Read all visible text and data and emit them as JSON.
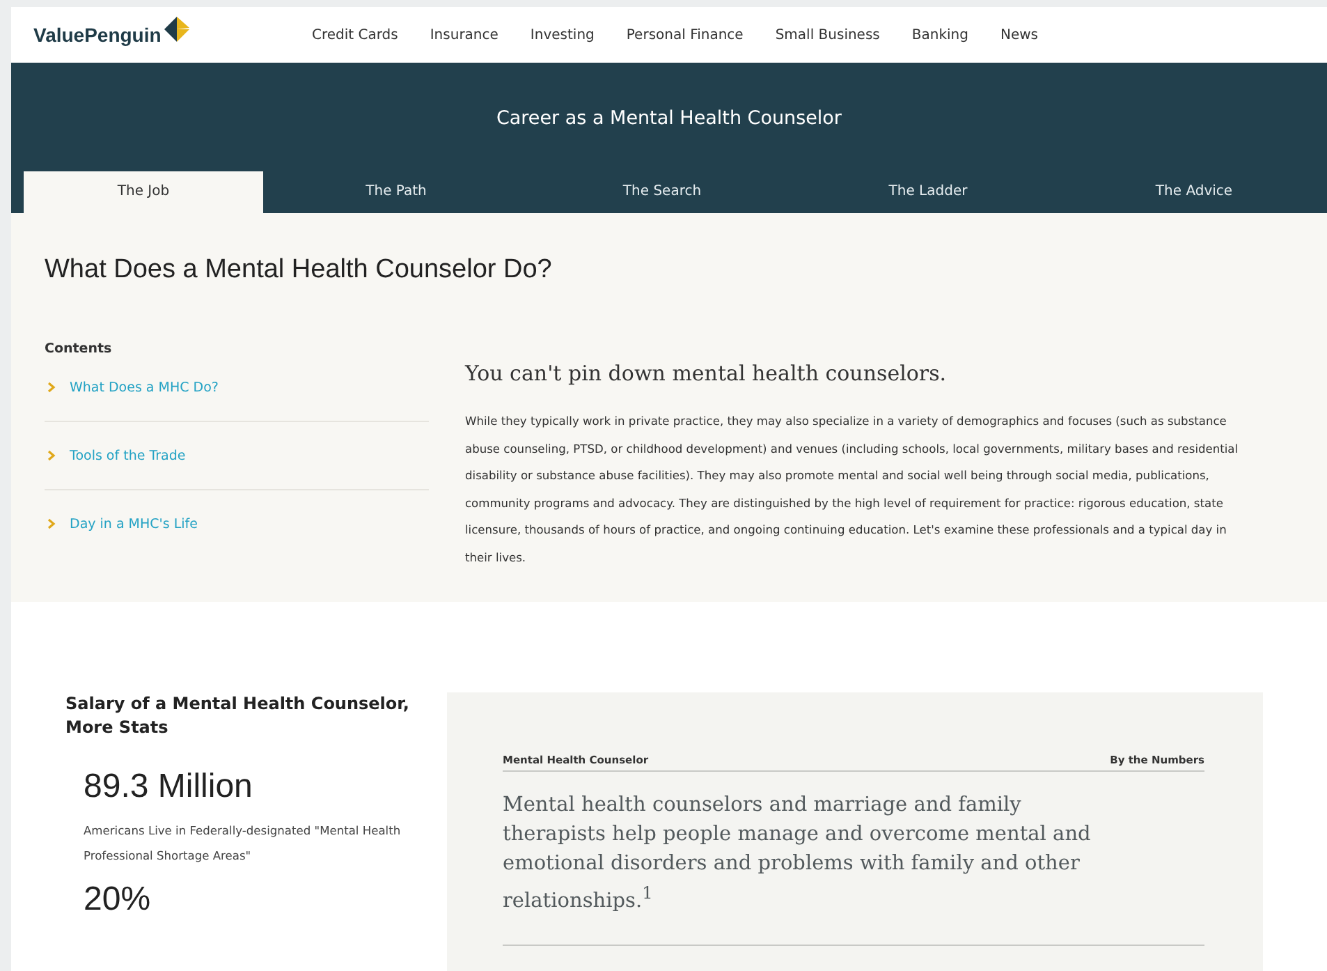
{
  "header": {
    "logo": "ValuePenguin",
    "nav": [
      "Credit Cards",
      "Insurance",
      "Investing",
      "Personal Finance",
      "Small Business",
      "Banking",
      "News"
    ]
  },
  "hero": {
    "title": "Career as a Mental Health Counselor",
    "tabs": [
      {
        "label": "The Job",
        "selected": true
      },
      {
        "label": "The Path",
        "selected": false
      },
      {
        "label": "The Search",
        "selected": false
      },
      {
        "label": "The Ladder",
        "selected": false
      },
      {
        "label": "The Advice",
        "selected": false
      }
    ]
  },
  "section": {
    "heading": "What Does a Mental Health Counselor Do?",
    "contents_title": "Contents",
    "contents": [
      "What Does a MHC Do?",
      "Tools of the Trade",
      "Day in a MHC's Life"
    ],
    "subheading": "You can't pin down mental health counselors.",
    "body": "While they typically work in private practice, they may also specialize in a variety of demographics and focuses (such as substance abuse counseling, PTSD, or childhood development) and venues (including schools, local governments, military bases and residential disability or substance abuse facilities). They may also promote mental and social well being through social media, publications, community programs and advocacy. They are distinguished by the high level of requirement for practice: rigorous education, state licensure, thousands of hours of practice, and ongoing continuing education. Let's examine these professionals and a typical day in their lives."
  },
  "stats": {
    "title": "Salary of a Mental Health Counselor, More Stats",
    "items": [
      {
        "value": "89.3 Million",
        "caption": "Americans Live in Federally-designated \"Mental Health Professional Shortage Areas\""
      },
      {
        "value": "20%"
      }
    ]
  },
  "numbers": {
    "left_label": "Mental Health Counselor",
    "right_label": "By the Numbers",
    "quote": "Mental health counselors and marriage and family therapists help people manage and overcome mental and emotional disorders and problems with family and other relationships.$^{1}$"
  }
}
